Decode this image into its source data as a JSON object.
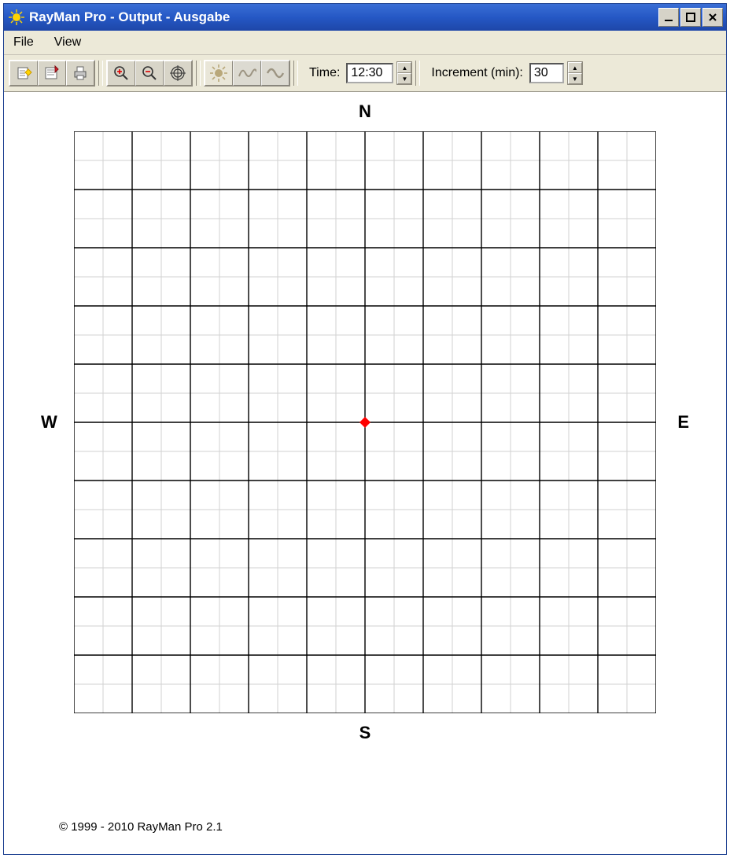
{
  "window": {
    "title": "RayMan Pro - Output - Ausgabe"
  },
  "menubar": {
    "file": "File",
    "view": "View"
  },
  "toolbar": {
    "time_label": "Time:",
    "time_value": "12:30",
    "increment_label": "Increment (min):",
    "increment_value": "30"
  },
  "chart_data": {
    "type": "scatter",
    "title": "",
    "xlabel": "",
    "ylabel": "",
    "labels": {
      "north": "N",
      "south": "S",
      "east": "E",
      "west": "W"
    },
    "xlim": [
      -1,
      1
    ],
    "ylim": [
      -1,
      1
    ],
    "grid": {
      "major_divisions": 10,
      "minor_per_major": 2
    },
    "series": [
      {
        "name": "marker",
        "x": [
          0
        ],
        "y": [
          0
        ],
        "color": "#ff0000",
        "shape": "diamond"
      }
    ]
  },
  "footer": {
    "copyright": "© 1999 - 2010 RayMan Pro 2.1"
  }
}
